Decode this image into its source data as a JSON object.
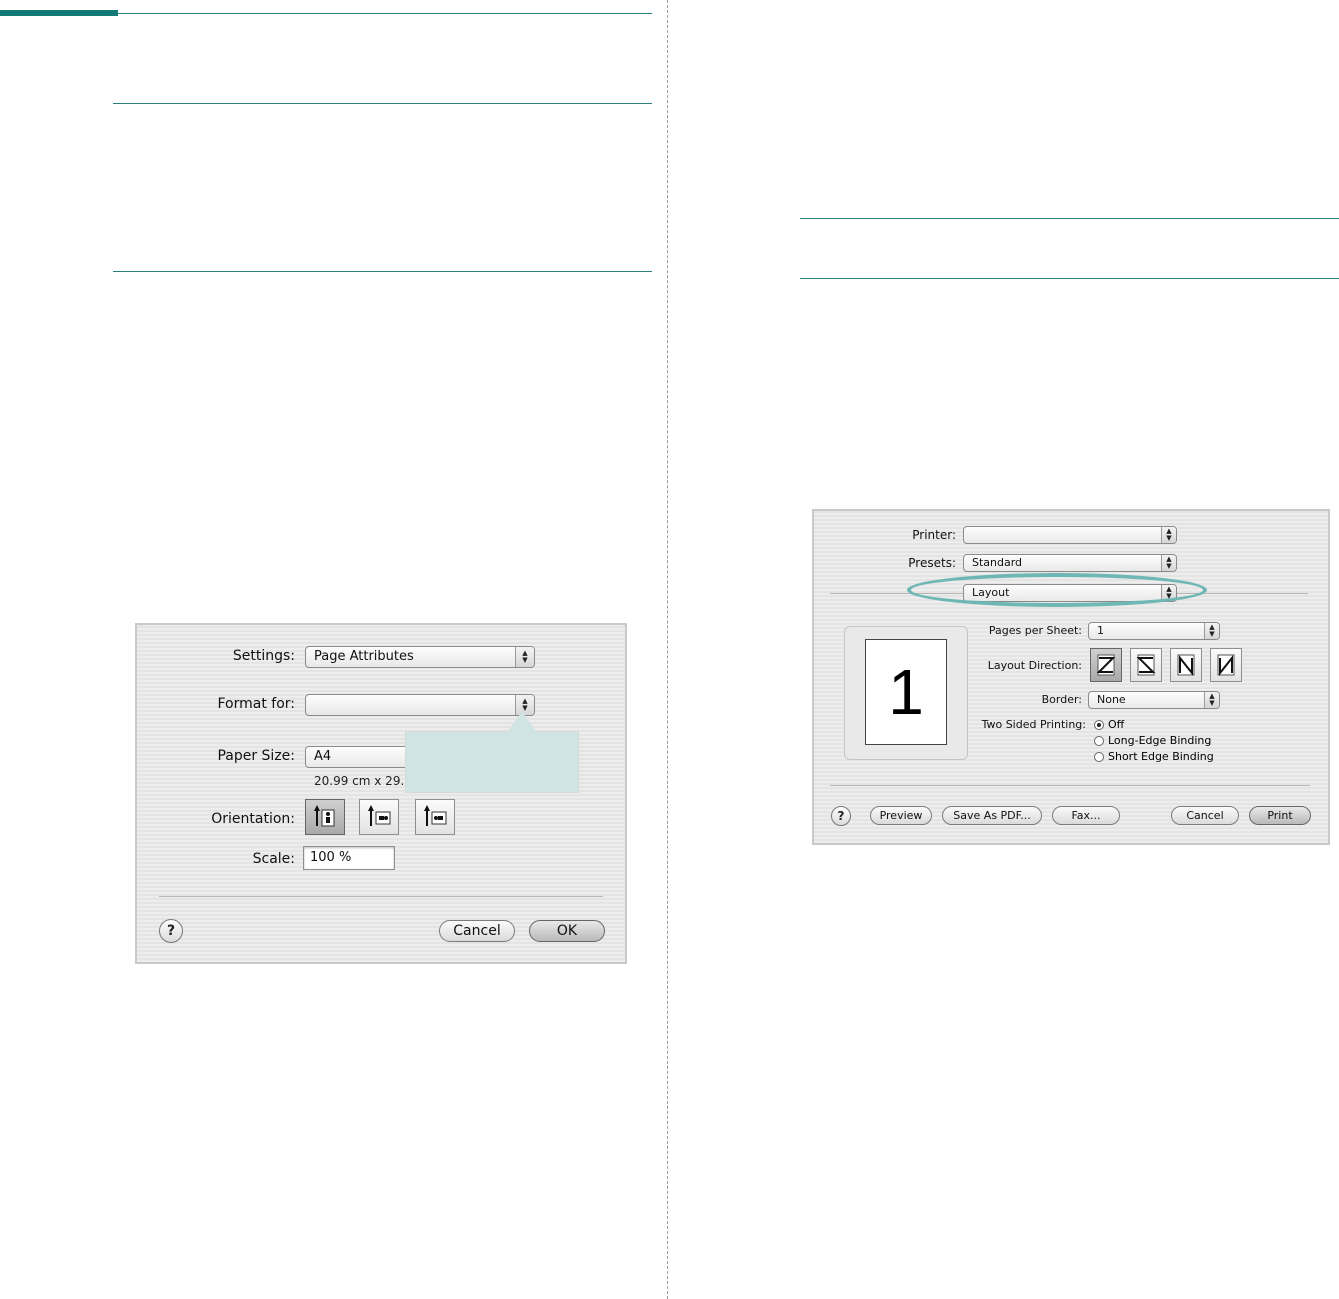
{
  "page_setup_dialog": {
    "settings_label": "Settings:",
    "settings_value": "Page Attributes",
    "format_for_label": "Format for:",
    "format_for_value": "",
    "paper_size_label": "Paper Size:",
    "paper_size_value": "A4",
    "paper_dimensions": "20.99 cm x 29.",
    "orientation_label": "Orientation:",
    "scale_label": "Scale:",
    "scale_value": "100 %",
    "help_label": "?",
    "cancel_label": "Cancel",
    "ok_label": "OK"
  },
  "print_dialog": {
    "printer_label": "Printer:",
    "printer_value": "",
    "presets_label": "Presets:",
    "presets_value": "Standard",
    "pane_value": "Layout",
    "page_preview_number": "1",
    "pages_per_sheet_label": "Pages per Sheet:",
    "pages_per_sheet_value": "1",
    "layout_direction_label": "Layout Direction:",
    "border_label": "Border:",
    "border_value": "None",
    "two_sided_label": "Two Sided Printing:",
    "two_sided_options": [
      "Off",
      "Long-Edge Binding",
      "Short Edge Binding"
    ],
    "two_sided_selected": "Off",
    "help_label": "?",
    "preview_label": "Preview",
    "save_pdf_label": "Save As PDF...",
    "fax_label": "Fax...",
    "cancel_label": "Cancel",
    "print_label": "Print"
  },
  "colors": {
    "accent_teal": "#0f7a76",
    "highlight_ring": "#6fb7b5",
    "callout_fill": "#cfe4e3"
  }
}
